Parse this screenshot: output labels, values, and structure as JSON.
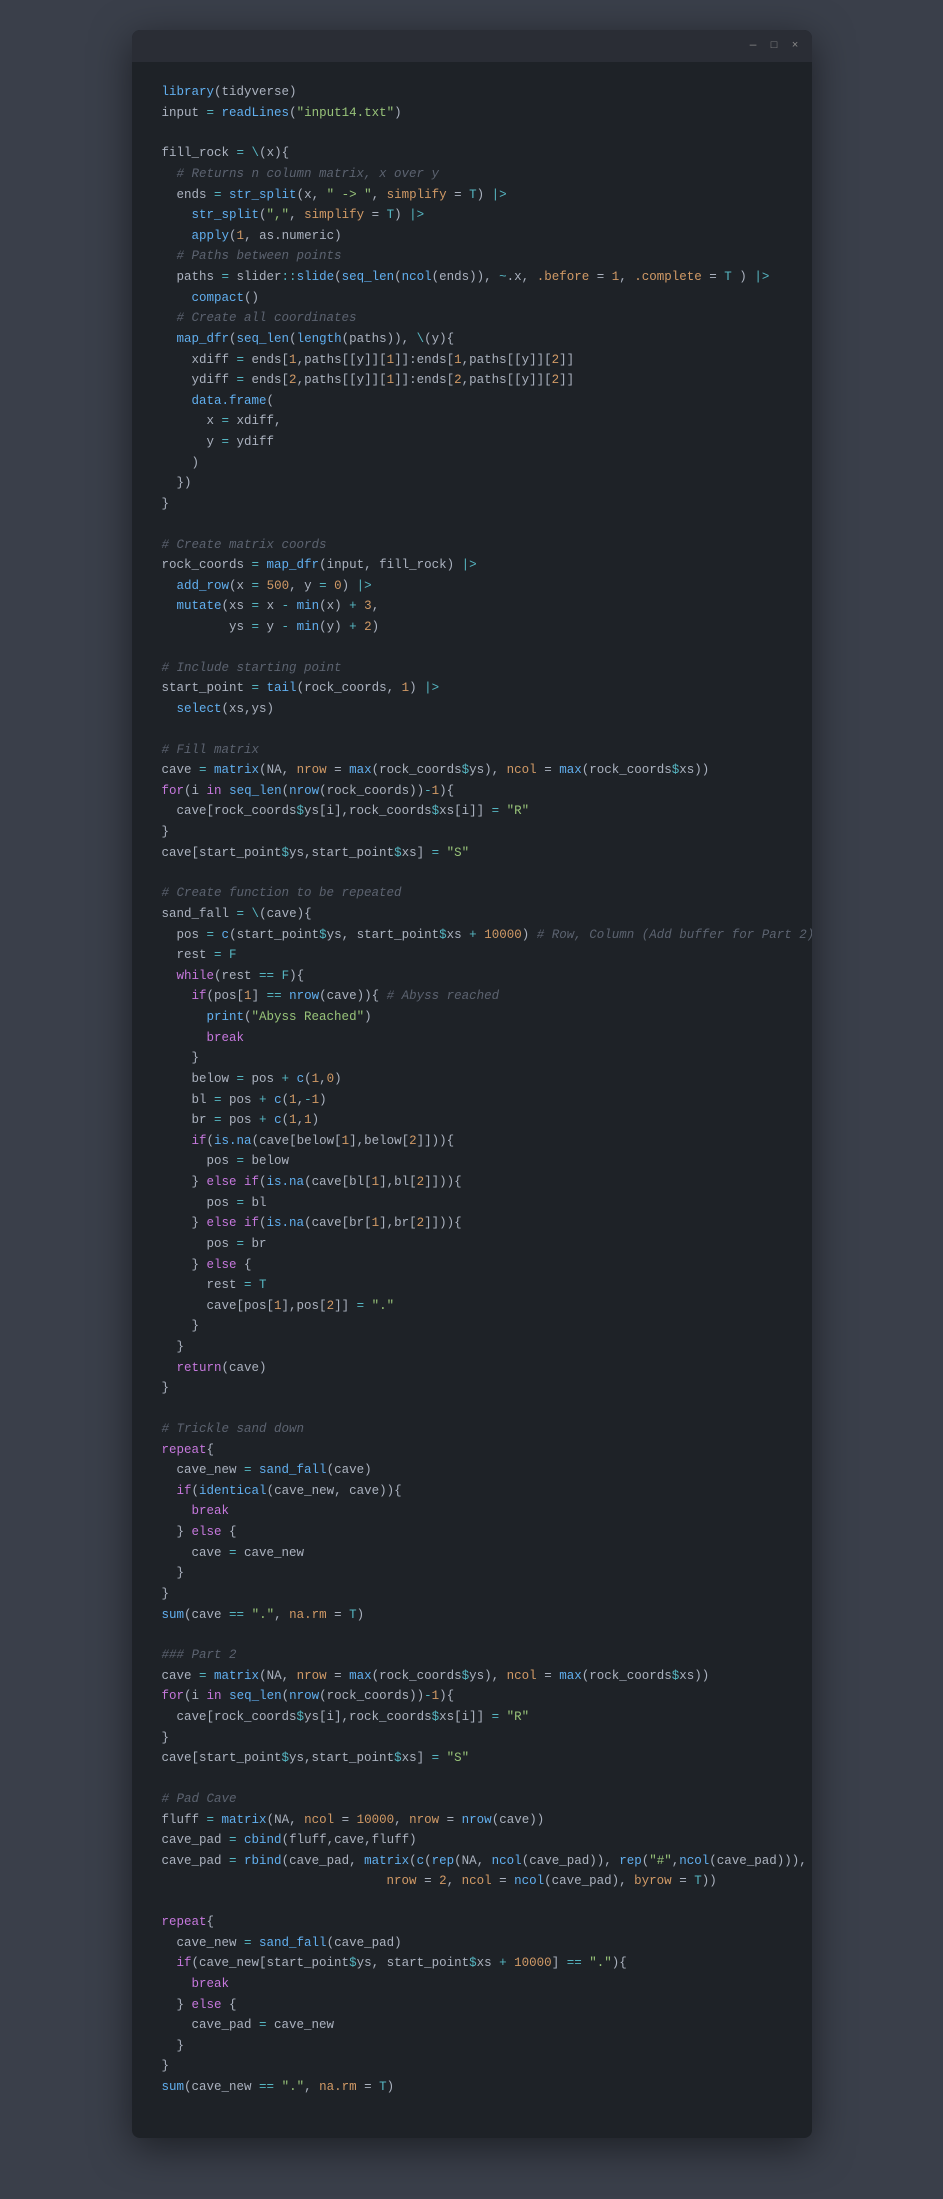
{
  "window": {
    "titlebar": {
      "minimize_label": "—",
      "maximize_label": "□",
      "close_label": "×"
    }
  },
  "code": {
    "lines": [
      {
        "text": "library(tidyverse)",
        "type": "code"
      },
      {
        "text": "input = readLines(\"input14.txt\")",
        "type": "code"
      },
      {
        "text": "",
        "type": "blank"
      },
      {
        "text": "fill_rock = \\(x){",
        "type": "code"
      },
      {
        "text": "  # Returns n column matrix, x over y",
        "type": "comment"
      },
      {
        "text": "  ends = str_split(x, \" -> \", simplify = T) |>",
        "type": "code"
      },
      {
        "text": "    str_split(\",\", simplify = T) |>",
        "type": "code"
      },
      {
        "text": "    apply(1, as.numeric)",
        "type": "code"
      },
      {
        "text": "  # Paths between points",
        "type": "comment"
      },
      {
        "text": "  paths = slider::slide(seq_len(ncol(ends)), ~.x, .before = 1, .complete = T ) |>",
        "type": "code"
      },
      {
        "text": "    compact()",
        "type": "code"
      },
      {
        "text": "  # Create all coordinates",
        "type": "comment"
      },
      {
        "text": "  map_dfr(seq_len(length(paths)), \\(y){",
        "type": "code"
      },
      {
        "text": "    xdiff = ends[1,paths[[y]][1]]:ends[1,paths[[y]][2]]",
        "type": "code"
      },
      {
        "text": "    ydiff = ends[2,paths[[y]][1]]:ends[2,paths[[y]][2]]",
        "type": "code"
      },
      {
        "text": "    data.frame(",
        "type": "code"
      },
      {
        "text": "      x = xdiff,",
        "type": "code"
      },
      {
        "text": "      y = ydiff",
        "type": "code"
      },
      {
        "text": "    )",
        "type": "code"
      },
      {
        "text": "  })",
        "type": "code"
      },
      {
        "text": "}",
        "type": "code"
      },
      {
        "text": "",
        "type": "blank"
      },
      {
        "text": "# Create matrix coords",
        "type": "comment"
      },
      {
        "text": "rock_coords = map_dfr(input, fill_rock) |>",
        "type": "code"
      },
      {
        "text": "  add_row(x = 500, y = 0) |>",
        "type": "code"
      },
      {
        "text": "  mutate(xs = x - min(x) + 3,",
        "type": "code"
      },
      {
        "text": "         ys = y - min(y) + 2)",
        "type": "code"
      },
      {
        "text": "",
        "type": "blank"
      },
      {
        "text": "# Include starting point",
        "type": "comment"
      },
      {
        "text": "start_point = tail(rock_coords, 1) |>",
        "type": "code"
      },
      {
        "text": "  select(xs,ys)",
        "type": "code"
      },
      {
        "text": "",
        "type": "blank"
      },
      {
        "text": "# Fill matrix",
        "type": "comment"
      },
      {
        "text": "cave = matrix(NA, nrow = max(rock_coords$ys), ncol = max(rock_coords$xs))",
        "type": "code"
      },
      {
        "text": "for(i in seq_len(nrow(rock_coords))-1){",
        "type": "code"
      },
      {
        "text": "  cave[rock_coords$ys[i],rock_coords$xs[i]] = \"R\"",
        "type": "code"
      },
      {
        "text": "}",
        "type": "code"
      },
      {
        "text": "cave[start_point$ys,start_point$xs] = \"S\"",
        "type": "code"
      },
      {
        "text": "",
        "type": "blank"
      },
      {
        "text": "# Create function to be repeated",
        "type": "comment"
      },
      {
        "text": "sand_fall = \\(cave){",
        "type": "code"
      },
      {
        "text": "  pos = c(start_point$ys, start_point$xs + 10000) # Row, Column (Add buffer for Part 2)",
        "type": "code"
      },
      {
        "text": "  rest = F",
        "type": "code"
      },
      {
        "text": "  while(rest == F){",
        "type": "code"
      },
      {
        "text": "    if(pos[1] == nrow(cave)){ # Abyss reached",
        "type": "code"
      },
      {
        "text": "      print(\"Abyss Reached\")",
        "type": "code"
      },
      {
        "text": "      break",
        "type": "code"
      },
      {
        "text": "    }",
        "type": "code"
      },
      {
        "text": "    below = pos + c(1,0)",
        "type": "code"
      },
      {
        "text": "    bl = pos + c(1,-1)",
        "type": "code"
      },
      {
        "text": "    br = pos + c(1,1)",
        "type": "code"
      },
      {
        "text": "    if(is.na(cave[below[1],below[2]])){",
        "type": "code"
      },
      {
        "text": "      pos = below",
        "type": "code"
      },
      {
        "text": "    } else if(is.na(cave[bl[1],bl[2]])){",
        "type": "code"
      },
      {
        "text": "      pos = bl",
        "type": "code"
      },
      {
        "text": "    } else if(is.na(cave[br[1],br[2]])){",
        "type": "code"
      },
      {
        "text": "      pos = br",
        "type": "code"
      },
      {
        "text": "    } else {",
        "type": "code"
      },
      {
        "text": "      rest = T",
        "type": "code"
      },
      {
        "text": "      cave[pos[1],pos[2]] = \".\"",
        "type": "code"
      },
      {
        "text": "    }",
        "type": "code"
      },
      {
        "text": "  }",
        "type": "code"
      },
      {
        "text": "  return(cave)",
        "type": "code"
      },
      {
        "text": "}",
        "type": "code"
      },
      {
        "text": "",
        "type": "blank"
      },
      {
        "text": "# Trickle sand down",
        "type": "comment"
      },
      {
        "text": "repeat{",
        "type": "code"
      },
      {
        "text": "  cave_new = sand_fall(cave)",
        "type": "code"
      },
      {
        "text": "  if(identical(cave_new, cave)){",
        "type": "code"
      },
      {
        "text": "    break",
        "type": "code"
      },
      {
        "text": "  } else {",
        "type": "code"
      },
      {
        "text": "    cave = cave_new",
        "type": "code"
      },
      {
        "text": "  }",
        "type": "code"
      },
      {
        "text": "}",
        "type": "code"
      },
      {
        "text": "sum(cave == \".\", na.rm = T)",
        "type": "code"
      },
      {
        "text": "",
        "type": "blank"
      },
      {
        "text": "### Part 2",
        "type": "comment"
      },
      {
        "text": "cave = matrix(NA, nrow = max(rock_coords$ys), ncol = max(rock_coords$xs))",
        "type": "code"
      },
      {
        "text": "for(i in seq_len(nrow(rock_coords))-1){",
        "type": "code"
      },
      {
        "text": "  cave[rock_coords$ys[i],rock_coords$xs[i]] = \"R\"",
        "type": "code"
      },
      {
        "text": "}",
        "type": "code"
      },
      {
        "text": "cave[start_point$ys,start_point$xs] = \"S\"",
        "type": "code"
      },
      {
        "text": "",
        "type": "blank"
      },
      {
        "text": "# Pad Cave",
        "type": "comment"
      },
      {
        "text": "fluff = matrix(NA, ncol = 10000, nrow = nrow(cave))",
        "type": "code"
      },
      {
        "text": "cave_pad = cbind(fluff,cave,fluff)",
        "type": "code"
      },
      {
        "text": "cave_pad = rbind(cave_pad, matrix(c(rep(NA, ncol(cave_pad)), rep(\"#\",ncol(cave_pad))),",
        "type": "code"
      },
      {
        "text": "                              nrow = 2, ncol = ncol(cave_pad), byrow = T))",
        "type": "code"
      },
      {
        "text": "",
        "type": "blank"
      },
      {
        "text": "repeat{",
        "type": "code"
      },
      {
        "text": "  cave_new = sand_fall(cave_pad)",
        "type": "code"
      },
      {
        "text": "  if(cave_new[start_point$ys, start_point$xs + 10000] == \".\"){",
        "type": "code"
      },
      {
        "text": "    break",
        "type": "code"
      },
      {
        "text": "  } else {",
        "type": "code"
      },
      {
        "text": "    cave_pad = cave_new",
        "type": "code"
      },
      {
        "text": "  }",
        "type": "code"
      },
      {
        "text": "}",
        "type": "code"
      },
      {
        "text": "sum(cave_new == \".\", na.rm = T)",
        "type": "code"
      }
    ]
  }
}
